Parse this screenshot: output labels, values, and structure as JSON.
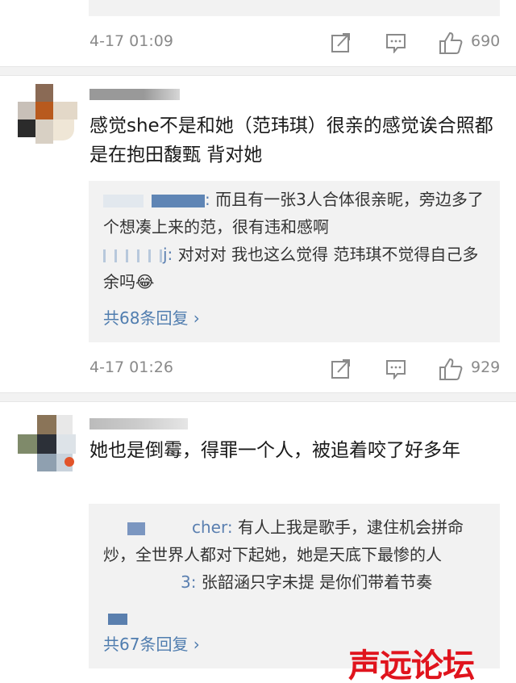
{
  "comments": [
    {
      "time": "4-17 01:09",
      "likes": "690"
    },
    {
      "text": "感觉she不是和她（范玮琪）很亲的感觉诶合照都是在抱田馥甄 背对她",
      "replies": [
        {
          "user_suffix": ":",
          "text": "而且有一张3人合体很亲昵，旁边多了个想凑上来的范，很有违和感啊"
        },
        {
          "user_suffix": "j:",
          "text": "对对对  我也这么觉得  范玮琪不觉得自己多余吗😂"
        }
      ],
      "more": "共68条回复 ›",
      "time": "4-17 01:26",
      "likes": "929"
    },
    {
      "text": "她也是倒霉，得罪一个人，被追着咬了好多年",
      "replies": [
        {
          "user_suffix": "cher:",
          "text": "有人上我是歌手，逮住机会拼命炒，全世界人都对下起她，她是天底下最惨的人"
        },
        {
          "user_suffix": "3:",
          "text": "张韶涵只字未提 是你们带着节奏"
        }
      ],
      "more": "共67条回复 ›"
    }
  ],
  "icons": {
    "repost": "repost-icon",
    "comment": "comment-icon",
    "like": "thumbs-up-icon"
  },
  "watermark": "声远论坛",
  "colors": {
    "link": "#507daf",
    "meta": "#8a8a8a",
    "reply_bg": "#f2f2f2",
    "watermark": "#e0141d"
  }
}
